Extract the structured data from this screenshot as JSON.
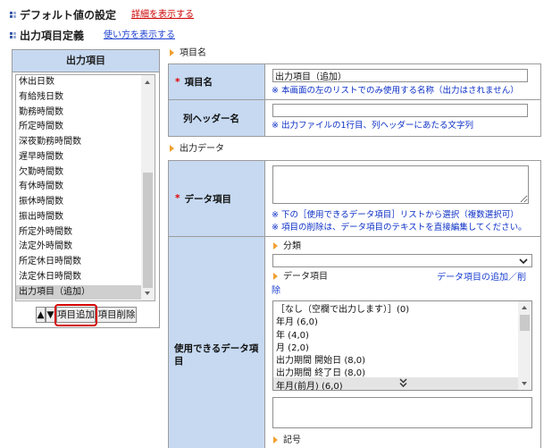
{
  "header": {
    "default_settings_title": "デフォルト値の設定",
    "default_settings_link": "詳細を表示する",
    "output_definition_title": "出力項目定義",
    "output_definition_link": "使い方を表示する"
  },
  "left_panel": {
    "title": "出力項目",
    "items": [
      "休出日数",
      "有給残日数",
      "勤務時間数",
      "所定時間数",
      "深夜勤務時間数",
      "遅早時間数",
      "欠勤時間数",
      "有休時間数",
      "振休時間数",
      "振出時間数",
      "所定外時間数",
      "法定外時間数",
      "所定休日時間数",
      "法定休日時間数",
      "出力項目（追加）"
    ],
    "selected_index": 14,
    "buttons": {
      "move_up": "▲",
      "move_down": "▼",
      "add": "項目追加",
      "delete": "項目削除"
    }
  },
  "item_name_section": {
    "heading": "項目名",
    "required_mark": "*",
    "name_label": "項目名",
    "name_value": "出力項目（追加）",
    "name_note": "※ 本画面の左のリストでのみ使用する名称（出力はされません）",
    "column_header_label": "列ヘッダー名",
    "column_header_value": "",
    "column_header_note": "※ 出力ファイルの1行目、列ヘッダーにあたる文字列"
  },
  "output_data_section": {
    "heading": "出力データ",
    "required_mark": "*",
    "data_item_label": "データ項目",
    "data_item_value": "",
    "data_item_notes": [
      "※ 下の［使用できるデータ項目］リストから選択（複数選択可）",
      "※ 項目の削除は、データ項目のテキストを直接編集してください。"
    ],
    "available_label": "使用できるデータ項目",
    "category_label": "分類",
    "category_selected": "",
    "data_items_label": "データ項目",
    "add_remove_link": "データ項目の追加／削除",
    "available_items": [
      "［なし（空欄で出力します）］(0)",
      "年月 (6,0)",
      "年 (4,0)",
      "月 (2,0)",
      "出力期間 開始日 (8,0)",
      "出力期間 終了日 (8,0)",
      "年月(前月) (6,0)"
    ],
    "extra_value": "",
    "symbol_label": "記号"
  },
  "icons": {
    "heading_marker": "grid-icon",
    "section_marker": "triangle-right-icon",
    "select_arrow": "chevron-down-icon",
    "list_overflow": "double-chevron-down-icon",
    "scroll_up": "scroll-up-arrow-icon",
    "scroll_down": "scroll-down-arrow-icon"
  },
  "colors": {
    "label_bg": "#c6d9f1",
    "border": "#9c9c9c",
    "link_red": "#cc0000",
    "link_blue": "#1c3fcf",
    "note_blue": "#0b2fc6",
    "required_red": "#e00000",
    "section_triangle": "#f0a030",
    "highlight": "#d40000",
    "selected_bg": "#cfcfcf"
  }
}
